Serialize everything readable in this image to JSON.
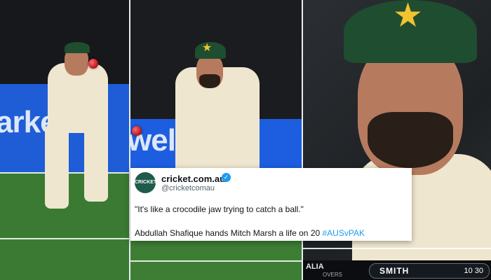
{
  "panels": {
    "left_ad_text": "arket",
    "middle_ad_text": "wel"
  },
  "tweet": {
    "avatar_text": "CRICKET",
    "display_name": "cricket.com.au",
    "handle": "@cricketcomau",
    "quote": "\"It's like a crocodile jaw trying to catch a ball.\"",
    "caption_text": "Abdullah Shafique hands Mitch Marsh a life on 20 ",
    "hashtag": "#AUSvPAK"
  },
  "scorebar": {
    "team": "ALIA",
    "overs_label": "OVERS",
    "batter": "SMITH",
    "runs": "10 30"
  },
  "colors": {
    "verified": "#1d9bf0",
    "hashtag": "#1d9bf0",
    "cap": "#1f4d2f",
    "ball": "#b3121d"
  }
}
